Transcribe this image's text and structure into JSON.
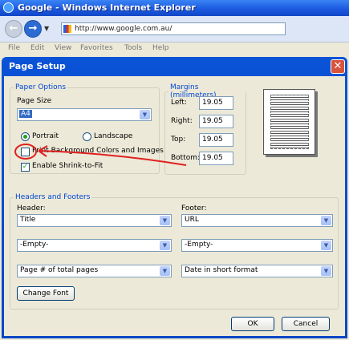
{
  "browser": {
    "title": "Google - Windows Internet Explorer",
    "address": "http://www.google.com.au/",
    "menu": [
      "File",
      "Edit",
      "View",
      "Favorites",
      "Tools",
      "Help"
    ]
  },
  "dialog": {
    "title": "Page Setup",
    "close_label": "✕",
    "paper_options": {
      "legend": "Paper Options",
      "page_size_label": "Page Size",
      "page_size_value": "A4",
      "orientation": {
        "portrait_label": "Portrait",
        "landscape_label": "Landscape",
        "selected": "portrait"
      },
      "print_background_label": "Print Background Colors and Images",
      "print_background_checked": false,
      "shrink_label": "Enable Shrink-to-Fit",
      "shrink_checked": true
    },
    "margins": {
      "legend": "Margins (millimeters)",
      "left_label": "Left:",
      "left_value": "19.05",
      "right_label": "Right:",
      "right_value": "19.05",
      "top_label": "Top:",
      "top_value": "19.05",
      "bottom_label": "Bottom:",
      "bottom_value": "19.05"
    },
    "headers_footers": {
      "legend": "Headers and Footers",
      "header_label": "Header:",
      "footer_label": "Footer:",
      "header_1": "Title",
      "header_2": "-Empty-",
      "header_3": "Page # of total pages",
      "footer_1": "URL",
      "footer_2": "-Empty-",
      "footer_3": "Date in short format",
      "change_font_label": "Change Font"
    },
    "ok_label": "OK",
    "cancel_label": "Cancel"
  },
  "annotation": {
    "color": "#e02020"
  }
}
